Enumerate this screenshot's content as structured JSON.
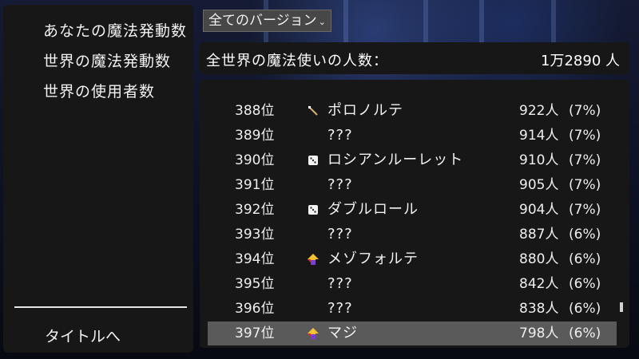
{
  "menu": {
    "items": [
      "あなたの魔法発動数",
      "世界の魔法発動数",
      "世界の使用者数"
    ],
    "back_label": "タイトルへ"
  },
  "version_select": {
    "label": "全てのバージョン"
  },
  "total": {
    "label": "全世界の魔法使いの人数：",
    "value": "1万2890 人"
  },
  "ranking": {
    "rows": [
      {
        "rank": "388位",
        "icon": "wand-icon",
        "name": "ポロノルテ",
        "count": "922人",
        "pct": "(7%)"
      },
      {
        "rank": "389位",
        "icon": "",
        "name": "???",
        "count": "914人",
        "pct": "(7%)"
      },
      {
        "rank": "390位",
        "icon": "dice-icon",
        "name": "ロシアンルーレット",
        "count": "910人",
        "pct": "(7%)"
      },
      {
        "rank": "391位",
        "icon": "",
        "name": "???",
        "count": "905人",
        "pct": "(7%)"
      },
      {
        "rank": "392位",
        "icon": "dice-icon",
        "name": "ダブルロール",
        "count": "904人",
        "pct": "(7%)"
      },
      {
        "rank": "393位",
        "icon": "",
        "name": "???",
        "count": "887人",
        "pct": "(6%)"
      },
      {
        "rank": "394位",
        "icon": "arrow-icon",
        "name": "メゾフォルテ",
        "count": "880人",
        "pct": "(6%)"
      },
      {
        "rank": "395位",
        "icon": "",
        "name": "???",
        "count": "842人",
        "pct": "(6%)"
      },
      {
        "rank": "396位",
        "icon": "",
        "name": "???",
        "count": "838人",
        "pct": "(6%)"
      },
      {
        "rank": "397位",
        "icon": "arrow-icon",
        "name": "マジ",
        "count": "798人",
        "pct": "(6%)"
      }
    ],
    "selected_index": 9
  }
}
